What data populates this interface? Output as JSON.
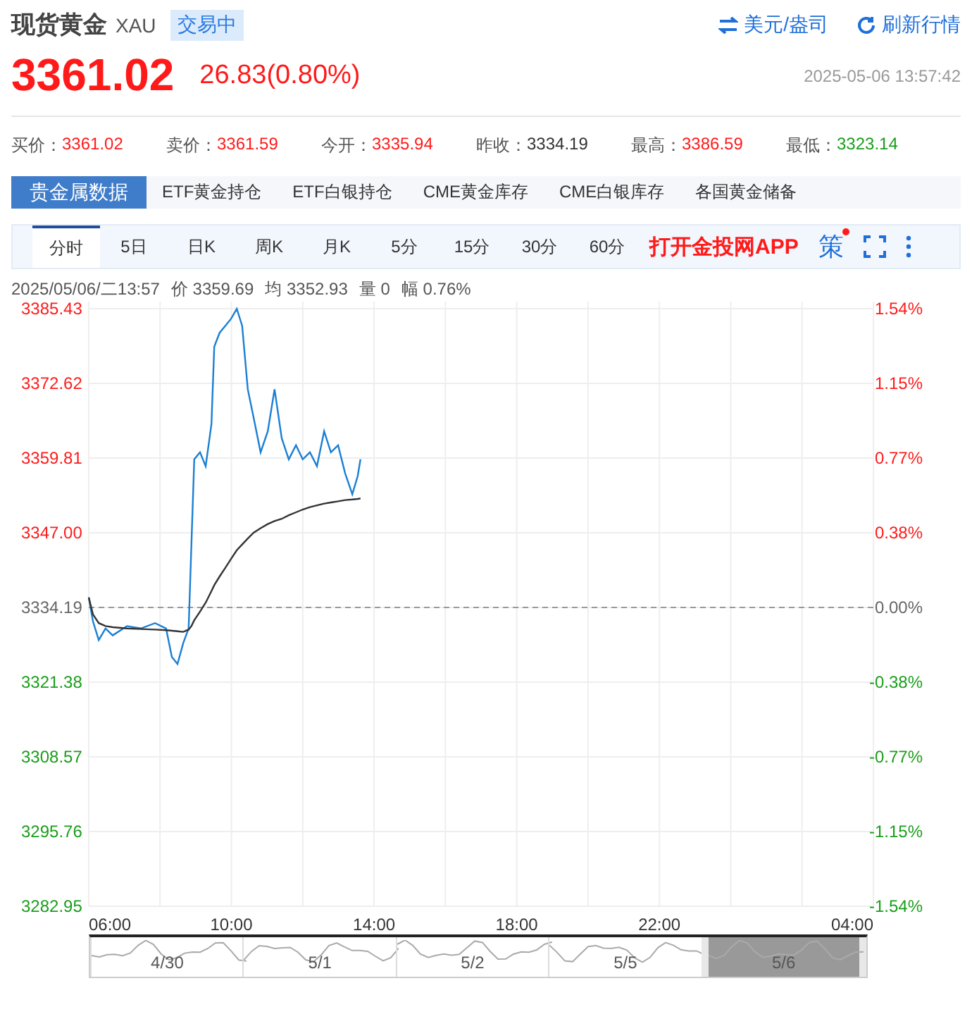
{
  "header": {
    "title": "现货黄金",
    "symbol": "XAU",
    "status": "交易中",
    "actions": [
      {
        "kind": "swap",
        "label": "美元/盎司"
      },
      {
        "kind": "refresh",
        "label": "刷新行情"
      }
    ]
  },
  "quote": {
    "price": "3361.02",
    "change": "26.83(0.80%)",
    "color": "#ff1a1a",
    "time": "2025-05-06 13:57:42"
  },
  "stats": [
    {
      "label": "买价：",
      "value": "3361.02",
      "color": "#ff1a1a"
    },
    {
      "label": "卖价：",
      "value": "3361.59",
      "color": "#ff1a1a"
    },
    {
      "label": "今开：",
      "value": "3335.94",
      "color": "#ff1a1a"
    },
    {
      "label": "昨收：",
      "value": "3334.19",
      "color": "#333333"
    },
    {
      "label": "最高：",
      "value": "3386.59",
      "color": "#ff1a1a"
    },
    {
      "label": "最低：",
      "value": "3323.14",
      "color": "#1a9e1a"
    }
  ],
  "data_tabs": [
    {
      "label": "贵金属数据",
      "selected": true
    },
    {
      "label": "ETF黄金持仓",
      "selected": false
    },
    {
      "label": "ETF白银持仓",
      "selected": false
    },
    {
      "label": "CME黄金库存",
      "selected": false
    },
    {
      "label": "CME白银库存",
      "selected": false
    },
    {
      "label": "各国黄金储备",
      "selected": false
    }
  ],
  "period_tabs": [
    {
      "label": "分时",
      "selected": true
    },
    {
      "label": "5日",
      "selected": false
    },
    {
      "label": "日K",
      "selected": false
    },
    {
      "label": "周K",
      "selected": false
    },
    {
      "label": "月K",
      "selected": false
    },
    {
      "label": "5分",
      "selected": false
    },
    {
      "label": "15分",
      "selected": false
    },
    {
      "label": "30分",
      "selected": false
    },
    {
      "label": "60分",
      "selected": false
    }
  ],
  "promo": "打开金投网APP",
  "tools": [
    {
      "kind": "text",
      "label": "策",
      "badge": true
    },
    {
      "kind": "fullscreen"
    },
    {
      "kind": "more"
    }
  ],
  "info_line": [
    {
      "value": "2025/05/06/二13:57"
    },
    {
      "label": "价",
      "value": "3359.69"
    },
    {
      "label": "均",
      "value": "3352.93"
    },
    {
      "label": "量",
      "value": "0"
    },
    {
      "label": "幅",
      "value": "0.76%"
    }
  ],
  "chart": {
    "chart_data": {
      "type": "line",
      "x": [
        6,
        6.12,
        6.28,
        6.47,
        6.67,
        7.07,
        7.46,
        7.86,
        8.17,
        8.33,
        8.49,
        8.65,
        8.8,
        8.88,
        8.96,
        9.12,
        9.28,
        9.44,
        9.52,
        9.67,
        9.83,
        9.99,
        10.15,
        10.3,
        10.46,
        10.62,
        10.82,
        11.02,
        11.21,
        11.41,
        11.61,
        11.81,
        12.0,
        12.2,
        12.4,
        12.6,
        12.79,
        12.99,
        13.19,
        13.39,
        13.54,
        13.62
      ],
      "series": [
        {
          "color": "#1a7fd4",
          "values": [
            3335.9,
            3331.8,
            3328.6,
            3330.6,
            3329.4,
            3331,
            3330.6,
            3331.5,
            3330.6,
            3325.7,
            3324.5,
            3328.1,
            3330.6,
            3345.1,
            3359.6,
            3360.8,
            3358.4,
            3365.6,
            3378.9,
            3381.3,
            3382.5,
            3383.7,
            3385.4,
            3382.5,
            3371.6,
            3366.8,
            3360.8,
            3364.4,
            3371.6,
            3363.2,
            3359.6,
            3362,
            3359.6,
            3360.8,
            3358.4,
            3364.4,
            3360.8,
            3362,
            3357.2,
            3353.6,
            3356.7,
            3359.6
          ]
        },
        {
          "color": "#333333",
          "values": [
            3335.9,
            3333,
            3331.5,
            3331,
            3330.8,
            3330.6,
            3330.5,
            3330.4,
            3330.3,
            3330.2,
            3330.1,
            3330,
            3330.4,
            3331,
            3332,
            3333.5,
            3335,
            3337,
            3338,
            3339.5,
            3341,
            3342.5,
            3344,
            3345,
            3346,
            3347,
            3347.8,
            3348.5,
            3349,
            3349.4,
            3350,
            3350.5,
            3351,
            3351.4,
            3351.7,
            3352,
            3352.2,
            3352.4,
            3352.6,
            3352.7,
            3352.8,
            3352.9
          ]
        }
      ],
      "xlim": [
        6,
        28
      ],
      "ylim": [
        3282.95,
        3385.43
      ],
      "xticks": [
        {
          "value": 6,
          "label": "06:00"
        },
        {
          "value": 10,
          "label": "10:00"
        },
        {
          "value": 14,
          "label": "14:00"
        },
        {
          "value": 18,
          "label": "18:00"
        },
        {
          "value": 22,
          "label": "22:00"
        }
      ],
      "yticks": [
        {
          "value": 3385.43,
          "label": "3385.43"
        },
        {
          "value": 3372.62,
          "label": "3372.62"
        },
        {
          "value": 3359.81,
          "label": "3359.81"
        },
        {
          "value": 3347,
          "label": "3347.00"
        },
        {
          "value": 3334.19,
          "label": "3334.19"
        },
        {
          "value": 3321.38,
          "label": "3321.38"
        },
        {
          "value": 3308.57,
          "label": "3308.57"
        },
        {
          "value": 3295.76,
          "label": "3295.76"
        },
        {
          "value": 3282.95,
          "label": "3282.95"
        }
      ],
      "grid": true,
      "ref_lines": [
        {
          "axis": "y",
          "value": 3334.19
        }
      ]
    },
    "x_end_label": "04:00",
    "right_ticks": [
      "1.54%",
      "1.15%",
      "0.77%",
      "0.38%",
      "0.00%",
      "-0.38%",
      "-0.77%",
      "-1.15%",
      "-1.54%"
    ]
  },
  "navigator": [
    {
      "label": "4/30",
      "selected": false
    },
    {
      "label": "5/1",
      "selected": false
    },
    {
      "label": "5/2",
      "selected": false
    },
    {
      "label": "5/5",
      "selected": false
    },
    {
      "label": "5/6",
      "selected": true
    }
  ]
}
